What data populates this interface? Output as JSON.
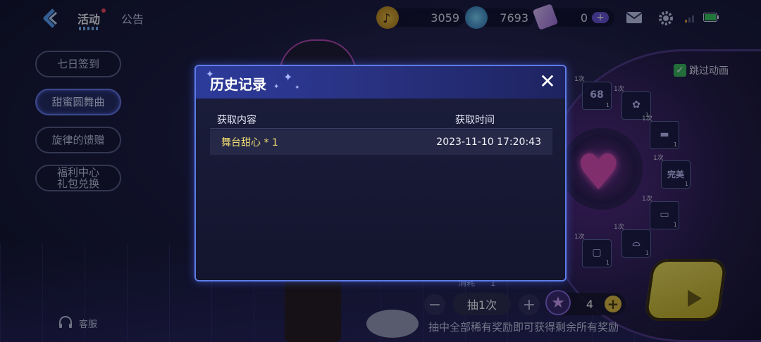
{
  "topbar": {
    "tabs": [
      {
        "label": "活动",
        "active": true,
        "has_dot": true
      },
      {
        "label": "公告",
        "active": false
      }
    ],
    "currencies": [
      {
        "icon": "music-note-coin-icon",
        "value": "3059"
      },
      {
        "icon": "blue-diamond-icon",
        "value": "7693"
      },
      {
        "icon": "ticket-icon",
        "value": "0"
      }
    ],
    "icons": [
      "mail-icon",
      "gear-icon",
      "signal-icon",
      "battery-icon"
    ]
  },
  "left_menu": {
    "items": [
      {
        "label": "七日签到",
        "active": false
      },
      {
        "label": "甜蜜圆舞曲",
        "active": true
      },
      {
        "label": "旋律的馈赠",
        "active": false
      },
      {
        "label": "福利中心\n礼包兑换",
        "active": false
      }
    ],
    "service_label": "客服"
  },
  "right_panel": {
    "skip_animation_label": "跳过动画",
    "skip_checked": true,
    "items": [
      {
        "count": "1次",
        "glyph": "68",
        "qty": "1"
      },
      {
        "count": "1次",
        "glyph": "✿",
        "qty": "1"
      },
      {
        "count": "1次",
        "glyph": "▬",
        "qty": "1"
      },
      {
        "count": "1次",
        "glyph": "完美",
        "qty": "1"
      },
      {
        "count": "1次",
        "glyph": "▭",
        "qty": "1"
      },
      {
        "count": "1次",
        "glyph": "⌓",
        "qty": "1"
      },
      {
        "count": "1次",
        "glyph": "▢",
        "qty": "1"
      }
    ],
    "history_tab_label": "历史记录"
  },
  "bottom": {
    "cost_label": "消耗",
    "cost_value": "1",
    "draw_label": "抽1次",
    "minus": "−",
    "plus": "+",
    "ticket_count": "4",
    "hint": "抽中全部稀有奖励即可获得剩余所有奖励"
  },
  "modal": {
    "title": "历史记录",
    "close": "✕",
    "columns": {
      "content": "获取内容",
      "time": "获取时间"
    },
    "rows": [
      {
        "content": "舞台甜心 * 1",
        "time": "2023-11-10 17:20:43"
      }
    ]
  },
  "colors": {
    "accent_blue": "#5e7ce8",
    "highlight_text": "#f2dd74",
    "play_button": "#f6e95a"
  }
}
